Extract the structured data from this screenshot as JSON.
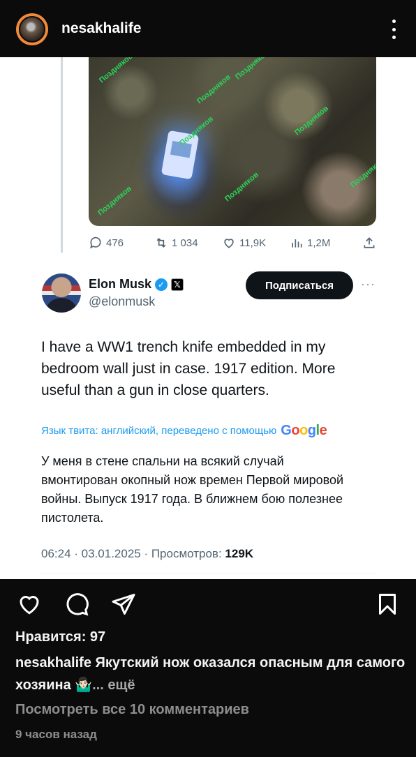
{
  "header": {
    "username": "nesakhalife",
    "menu_icon": "more-vertical-icon"
  },
  "tweet": {
    "watermark": "Позднякoв",
    "actions": {
      "replies": "476",
      "reposts": "1 034",
      "likes": "11,9K",
      "views": "1,2M"
    },
    "author_name": "Elon Musk",
    "author_handle": "@elonmusk",
    "follow_label": "Подписаться",
    "more_label": "···",
    "text": "I have a WW1 trench knife embedded in my bedroom wall just in case. 1917 edition. More useful than a gun in close quarters.",
    "translate_note": "Язык твита: английский, переведено с помощью",
    "translate_brand": "Google",
    "translation": "У меня в стене спальни на всякий случай вмонтирован окопный нож времен Первой мировой войны. Выпуск 1917 года. В ближнем бою полезнее пистолета.",
    "meta_prefix": "06:24 · 03.01.2025 · Просмотров: ",
    "meta_views": "129K"
  },
  "post": {
    "likes_text": "Нравится: 97",
    "caption_user": "nesakhalife",
    "caption_text": " Якутский нож оказался опасным для самого хозяина 🤷🏻‍♂️",
    "caption_more": "... ещё",
    "view_comments": "Посмотреть все 10 комментариев",
    "time_ago": "9 часов назад"
  },
  "colors": {
    "bar_bg": "#0b0b0b",
    "avatar_ring": "#f08a3a",
    "twitter_blue": "#1d9bf0",
    "muted": "#8e8e8e"
  }
}
